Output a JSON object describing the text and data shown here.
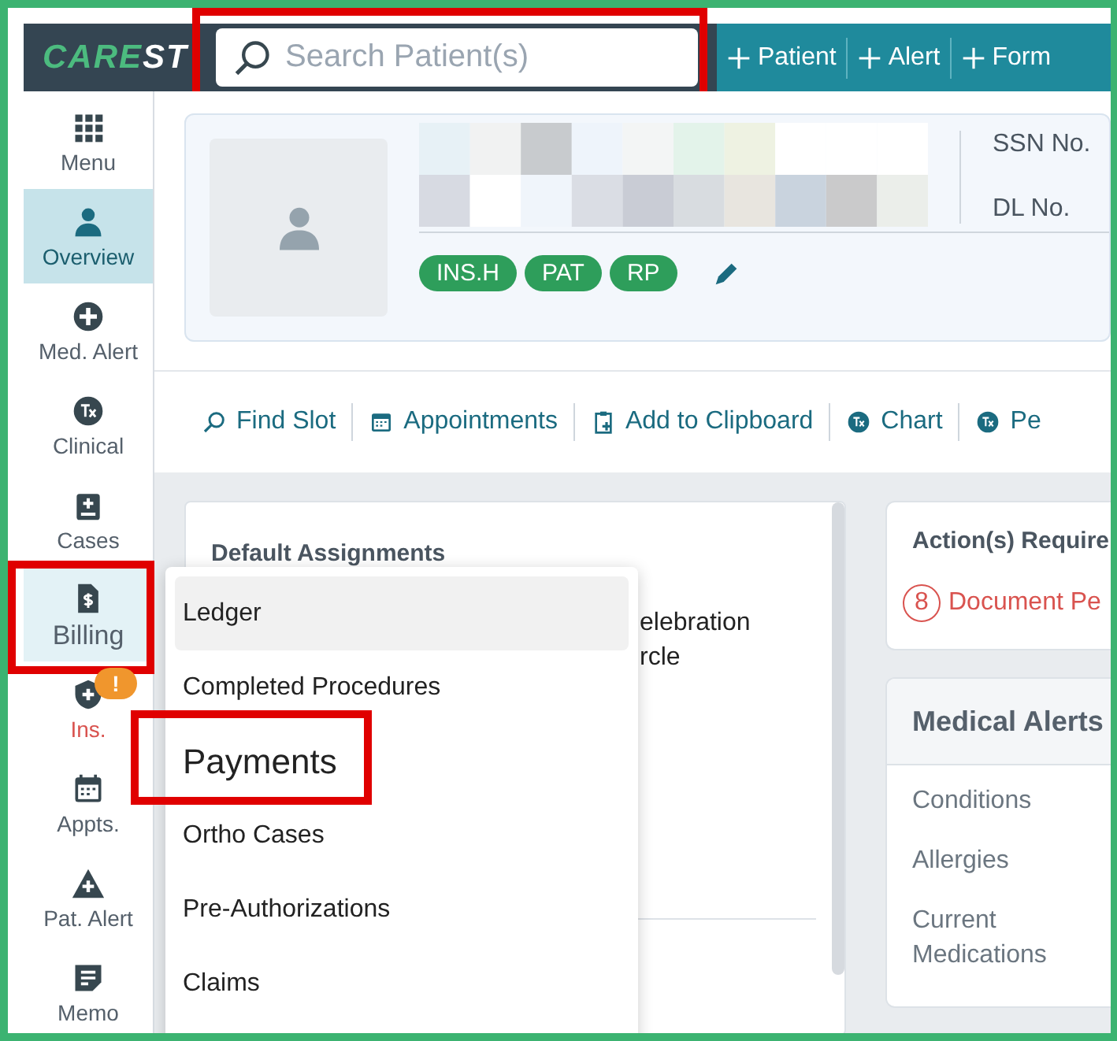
{
  "logo": {
    "part_1": "CARE",
    "part_2": "ST"
  },
  "search": {
    "placeholder": "Search Patient(s)",
    "highlighted": true
  },
  "quick_actions": [
    {
      "label": "Patient"
    },
    {
      "label": "Alert"
    },
    {
      "label": "Form"
    }
  ],
  "sidebar": {
    "items": [
      {
        "label": "Menu",
        "kind": "grid",
        "selected": false,
        "open": false,
        "warning": false
      },
      {
        "label": "Overview",
        "kind": "person",
        "selected": true,
        "open": false,
        "warning": false
      },
      {
        "label": "Med. Alert",
        "kind": "plus",
        "selected": false,
        "open": false,
        "warning": false
      },
      {
        "label": "Clinical",
        "kind": "tx",
        "selected": false,
        "open": false,
        "warning": false
      },
      {
        "label": "Cases",
        "kind": "case",
        "selected": false,
        "open": false,
        "warning": false
      },
      {
        "label": "Billing",
        "kind": "bill",
        "selected": false,
        "open": true,
        "warning": false,
        "highlighted": true
      },
      {
        "label": "Ins.",
        "kind": "shield",
        "selected": false,
        "open": false,
        "warning": true,
        "badge": "!"
      },
      {
        "label": "Appts.",
        "kind": "calendar",
        "selected": false,
        "open": false,
        "warning": false
      },
      {
        "label": "Pat. Alert",
        "kind": "triangle",
        "selected": false,
        "open": false,
        "warning": false
      },
      {
        "label": "Memo",
        "kind": "memo",
        "selected": false,
        "open": false,
        "warning": false
      }
    ]
  },
  "patient": {
    "fields": [
      "SSN No.",
      "DL No."
    ],
    "tags": [
      "INS.H",
      "PAT",
      "RP"
    ]
  },
  "toolbar": [
    {
      "label": "Find Slot",
      "kind": "search"
    },
    {
      "label": "Appointments",
      "kind": "calendar"
    },
    {
      "label": "Add to Clipboard",
      "kind": "clipboard"
    },
    {
      "label": "Chart",
      "kind": "tx"
    },
    {
      "label": "Pe",
      "kind": "tx"
    }
  ],
  "assignments": {
    "title": "Default Assignments",
    "lines": [
      "elebration",
      "rcle"
    ]
  },
  "actions": {
    "title": "Action(s) Require",
    "count": "8",
    "item": "Document Pe"
  },
  "medical_alerts": {
    "title": "Medical Alerts",
    "rows": [
      "Conditions",
      "Allergies",
      "Current Medications"
    ]
  },
  "billing_menu": {
    "items": [
      {
        "label": "Ledger",
        "selected": true,
        "highlighted": false
      },
      {
        "label": "Completed Procedures",
        "selected": false,
        "highlighted": false
      },
      {
        "label": "Payments",
        "selected": false,
        "highlighted": true
      },
      {
        "label": "Ortho Cases",
        "selected": false,
        "highlighted": false
      },
      {
        "label": "Pre-Authorizations",
        "selected": false,
        "highlighted": false
      },
      {
        "label": "Claims",
        "selected": false,
        "highlighted": false
      }
    ]
  }
}
